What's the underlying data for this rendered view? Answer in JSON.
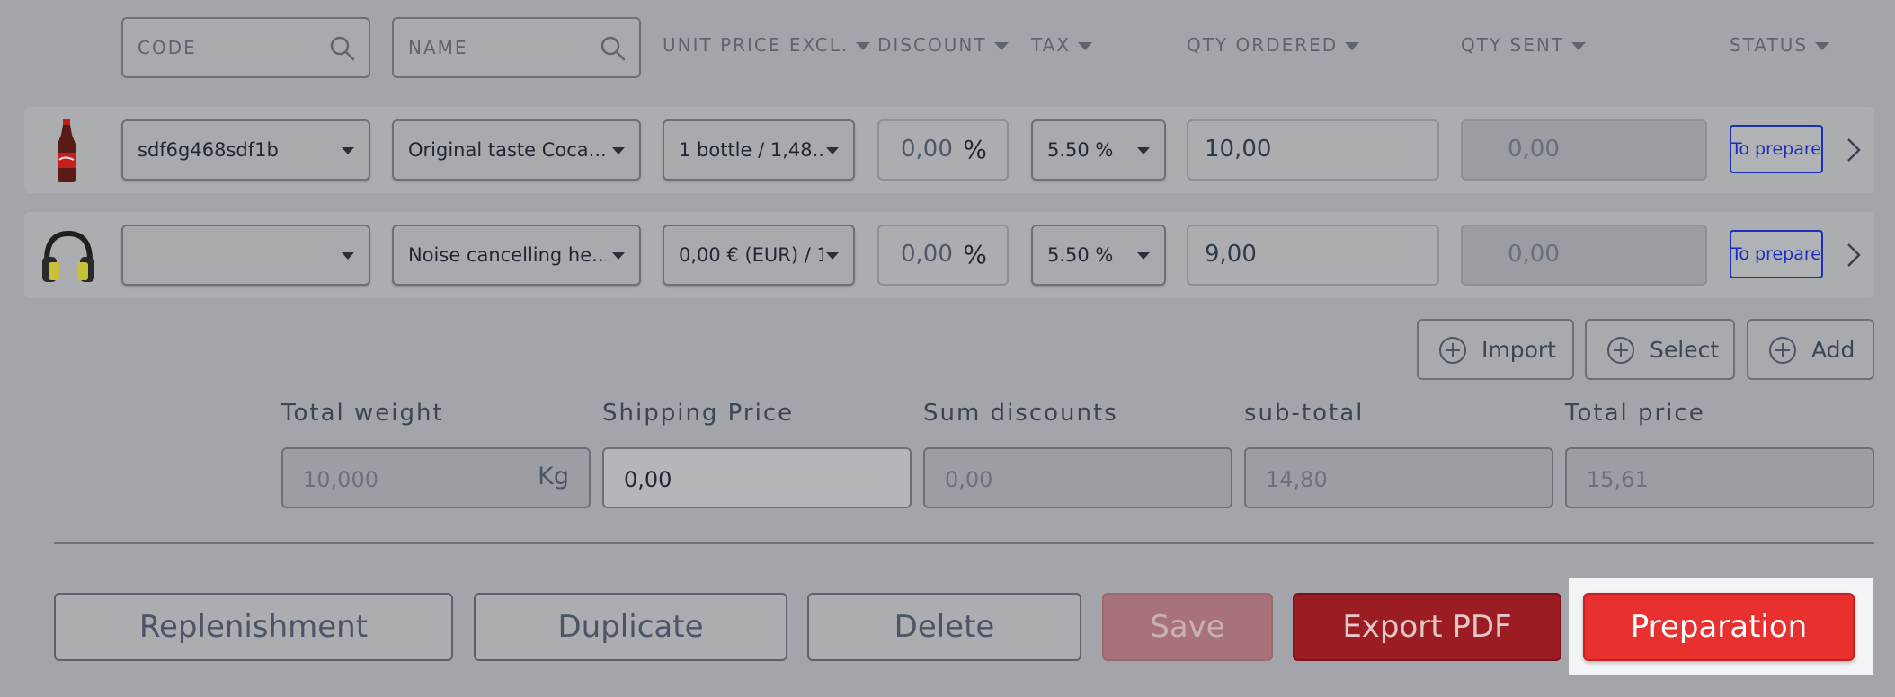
{
  "filters": {
    "code_placeholder": "CODE",
    "name_placeholder": "NAME"
  },
  "columns": {
    "unit_price": "UNIT PRICE EXCL.",
    "discount": "DISCOUNT",
    "tax": "TAX",
    "qty_ordered": "QTY ORDERED",
    "qty_sent": "QTY SENT",
    "status": "STATUS"
  },
  "rows": [
    {
      "product_image": "coca-cola-bottle",
      "code": "sdf6g468sdf1b",
      "name": "Original taste Coca...",
      "unit_price": "1 bottle / 1,48...",
      "discount": "0,00",
      "discount_unit": "%",
      "tax": "5.50 %",
      "qty_ordered": "10,00",
      "qty_sent": "0,00",
      "status": "To prepare"
    },
    {
      "product_image": "headphones",
      "code": "",
      "name": "Noise cancelling he...",
      "unit_price": "0,00 € (EUR) / 1",
      "discount": "0,00",
      "discount_unit": "%",
      "tax": "5.50 %",
      "qty_ordered": "9,00",
      "qty_sent": "0,00",
      "status": "To prepare"
    }
  ],
  "row_actions": {
    "import": "Import",
    "select": "Select",
    "add": "Add"
  },
  "totals": {
    "weight_label": "Total weight",
    "weight_value": "10,000",
    "weight_unit": "Kg",
    "shipping_label": "Shipping Price",
    "shipping_value": "0,00",
    "discounts_label": "Sum discounts",
    "discounts_value": "0,00",
    "subtotal_label": "sub-total",
    "subtotal_value": "14,80",
    "total_label": "Total price",
    "total_value": "15,61"
  },
  "footer": {
    "replenishment": "Replenishment",
    "duplicate": "Duplicate",
    "delete": "Delete",
    "save": "Save",
    "export_pdf": "Export PDF",
    "preparation": "Preparation"
  },
  "colors": {
    "overlay_bg": "#a4a5aa",
    "status_blue": "#1a2fbb",
    "export_red": "#9b1c22",
    "preparation_red": "#e8302f"
  }
}
